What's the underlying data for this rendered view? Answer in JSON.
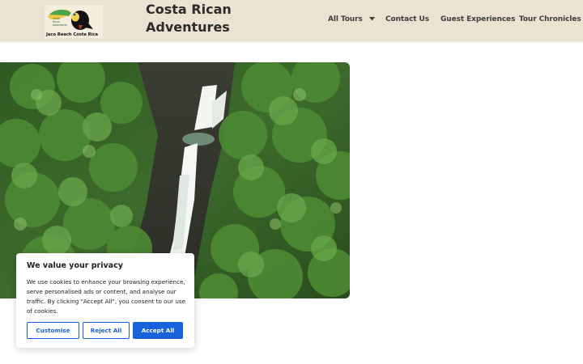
{
  "header": {
    "logo": {
      "caption": "Jaco Beach Costa Rica",
      "small_text": [
        "Costa",
        "Rican",
        "Adventures"
      ]
    },
    "site_title": "Costa Rican Adventures",
    "nav": {
      "tours": "All Tours",
      "contact": "Contact Us",
      "guest": "Guest Experiences",
      "chronicles": "Tour Chronicles"
    }
  },
  "cookie_banner": {
    "title": "We value your privacy",
    "body": "We use cookies to enhance your browsing experience, serve personalised ads or content, and analyse our traffic. By clicking \"Accept All\", you consent to our use of cookies.",
    "customise": "Customise",
    "reject": "Reject All",
    "accept": "Accept All"
  },
  "colors": {
    "header_bg": "#ece2d1",
    "accent": "#1863dc"
  }
}
